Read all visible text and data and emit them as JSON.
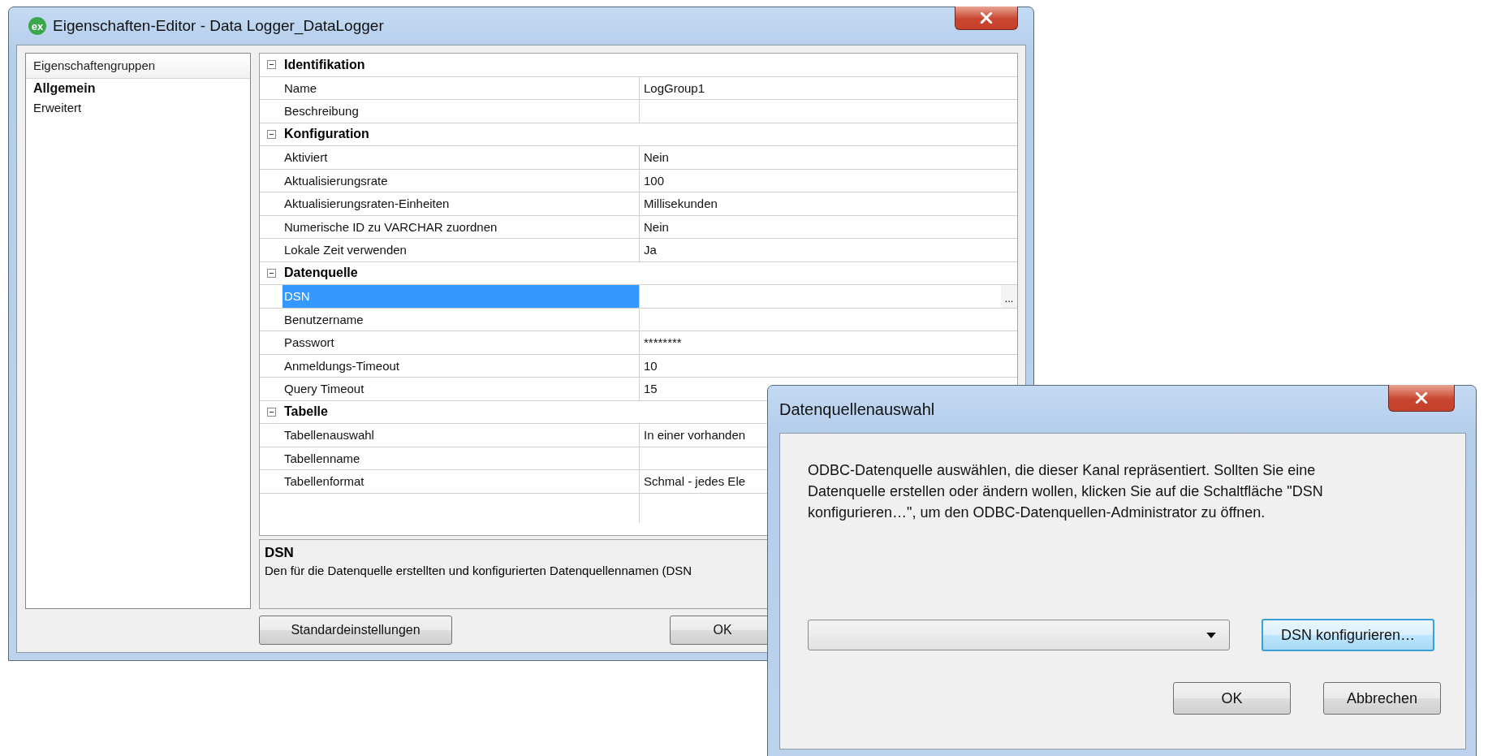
{
  "window": {
    "icon_label": "ex",
    "title": "Eigenschaften-Editor - Data Logger_DataLogger"
  },
  "sidebar": {
    "header": "Eigenschaftengruppen",
    "items": [
      {
        "label": "Allgemein",
        "selected": true
      },
      {
        "label": "Erweitert",
        "selected": false
      }
    ]
  },
  "property_grid": {
    "categories": [
      {
        "name": "Identifikation",
        "expanded": true,
        "properties": [
          {
            "name": "Name",
            "value": "LogGroup1",
            "selected": false
          },
          {
            "name": "Beschreibung",
            "selected": false
          }
        ]
      },
      {
        "name": "Konfiguration",
        "expanded": true,
        "properties": [
          {
            "name": "Aktiviert",
            "value": "Nein",
            "selected": false
          },
          {
            "name": "Aktualisierungsrate",
            "value": "100",
            "selected": false
          },
          {
            "name": "Aktualisierungsraten-Einheiten",
            "value": "Millisekunden",
            "selected": false
          },
          {
            "name": "Numerische ID zu VARCHAR zuordnen",
            "value": "Nein",
            "selected": false
          },
          {
            "name": "Lokale Zeit verwenden",
            "value": "Ja",
            "selected": false
          }
        ]
      },
      {
        "name": "Datenquelle",
        "expanded": true,
        "properties": [
          {
            "name": "DSN",
            "selected": true,
            "button": "..."
          },
          {
            "name": "Benutzername",
            "selected": false
          },
          {
            "name": "Passwort",
            "value": "********",
            "selected": false
          },
          {
            "name": "Anmeldungs-Timeout",
            "value": "10",
            "selected": false
          },
          {
            "name": "Query Timeout",
            "value": "15",
            "selected": false
          }
        ]
      },
      {
        "name": "Tabelle",
        "expanded": true,
        "properties": [
          {
            "name": "Tabellenauswahl",
            "value": "In einer vorhanden",
            "selected": false
          },
          {
            "name": "Tabellenname",
            "selected": false
          },
          {
            "name": "Tabellenformat",
            "value": "Schmal - jedes Ele",
            "selected": false
          }
        ]
      }
    ]
  },
  "description": {
    "title": "DSN",
    "text": "Den für die Datenquelle erstellten und konfigurierten Datenquellennamen (DSN"
  },
  "buttons": [
    {
      "label": "Standardeinstellungen",
      "kind": "defaults"
    },
    {
      "label": "OK",
      "kind": "ok"
    }
  ],
  "dialog": {
    "title": "Datenquellenauswahl",
    "message": "ODBC-Datenquelle auswählen, die dieser Kanal repräsentiert. Sollten Sie eine Datenquelle erstellen oder ändern wollen, klicken Sie auf die Schaltfläche \"DSN konfigurieren…\", um den ODBC-Datenquellen-Administrator zu öffnen.",
    "configure_button": {
      "label": "DSN konfigurieren…",
      "focused": true
    },
    "buttons": [
      {
        "label": "OK",
        "focused": false
      },
      {
        "label": "Abbrechen",
        "focused": false
      }
    ]
  }
}
